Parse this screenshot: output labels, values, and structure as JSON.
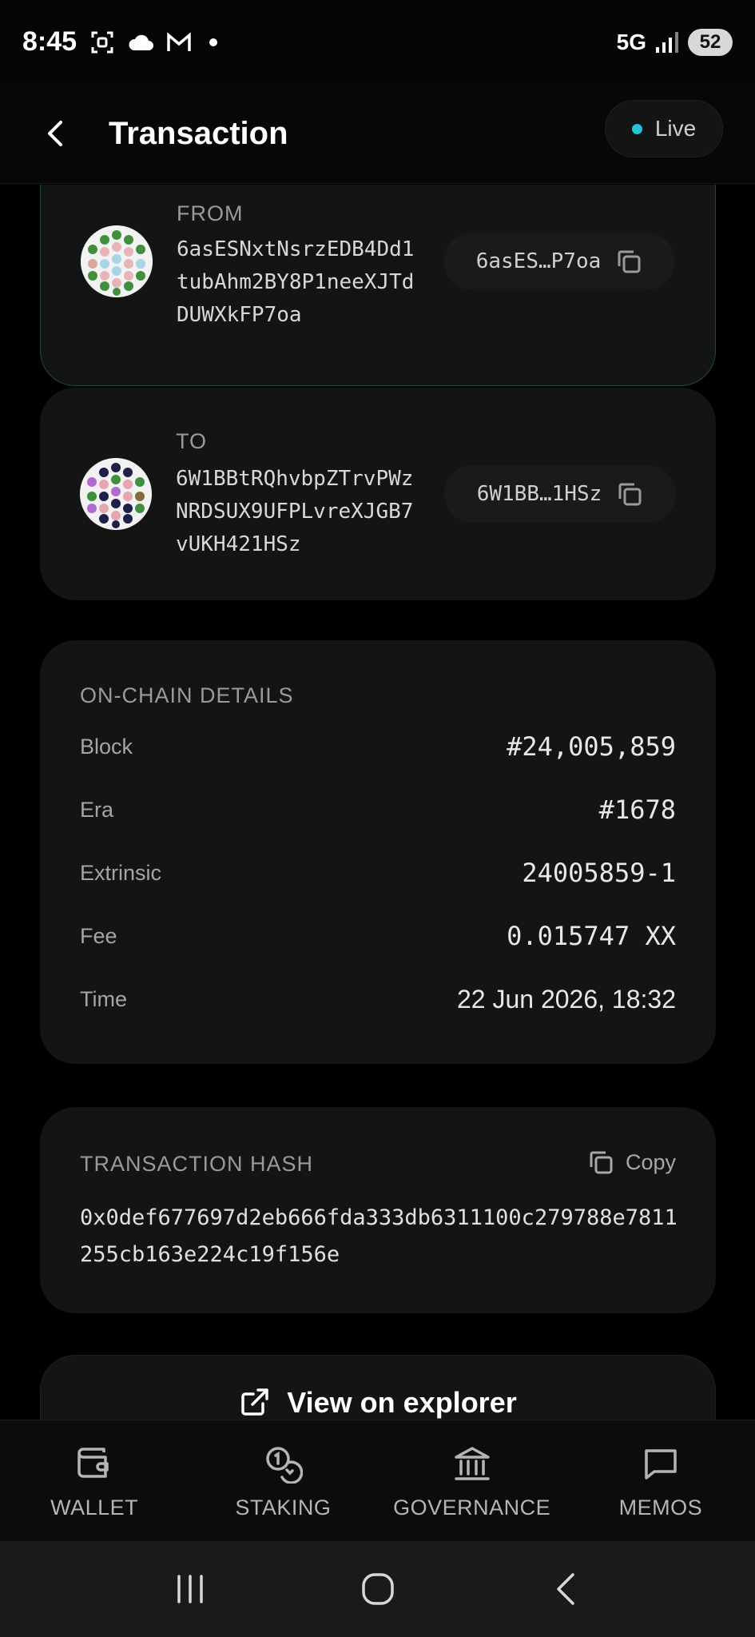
{
  "status_bar": {
    "time": "8:45",
    "network": "5G",
    "battery": "52"
  },
  "header": {
    "title": "Transaction",
    "live_label": "Live"
  },
  "from": {
    "label": "FROM",
    "address": "6asESNxtNsrzEDB4Dd1tubAhm2BY8P1neeXJTdDUWXkFP7oa",
    "short": "6asES…P7oa"
  },
  "to": {
    "label": "TO",
    "address": "6W1BBtRQhvbpZTrvPWzNRDSUX9UFPLvreXJGB7vUKH421HSz",
    "short": "6W1BB…1HSz"
  },
  "details": {
    "title": "ON-CHAIN DETAILS",
    "rows": [
      {
        "label": "Block",
        "value": "#24,005,859"
      },
      {
        "label": "Era",
        "value": "#1678"
      },
      {
        "label": "Extrinsic",
        "value": "24005859-1"
      },
      {
        "label": "Fee",
        "value": "0.015747 XX"
      },
      {
        "label": "Time",
        "value": "22 Jun 2026, 18:32"
      }
    ]
  },
  "hash": {
    "title": "TRANSACTION HASH",
    "copy_label": "Copy",
    "value": "0x0def677697d2eb666fda333db6311100c279788e7811255cb163e224c19f156e"
  },
  "explorer": {
    "label": "View on explorer"
  },
  "nav": {
    "items": [
      {
        "label": "WALLET",
        "icon": "wallet-icon"
      },
      {
        "label": "STAKING",
        "icon": "coins-icon"
      },
      {
        "label": "GOVERNANCE",
        "icon": "bank-icon"
      },
      {
        "label": "MEMOS",
        "icon": "chat-icon"
      }
    ]
  },
  "colors": {
    "accent": "#22c4d8",
    "from_border": "#1d4a48",
    "card": "#141414"
  }
}
